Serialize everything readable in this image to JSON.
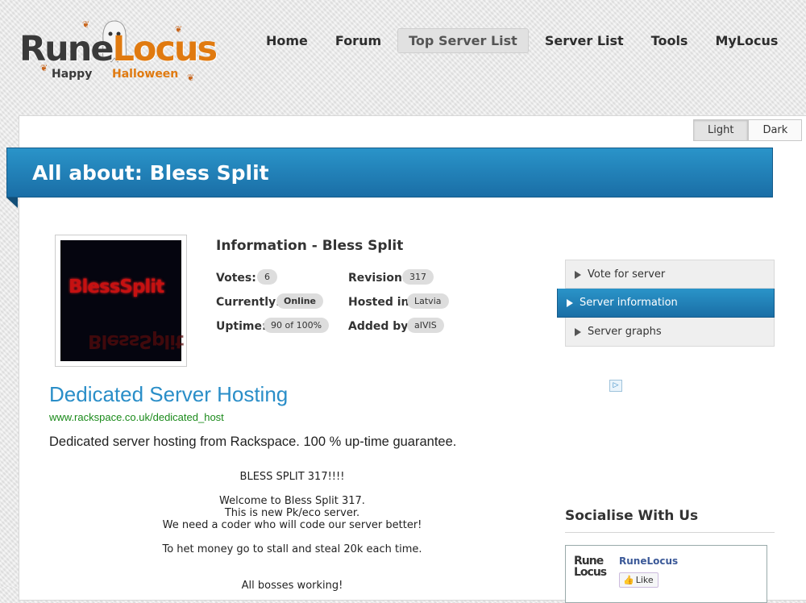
{
  "logo": {
    "word1": "Rune",
    "word2": "Locus",
    "happy": "Happy",
    "halloween": "Halloween"
  },
  "nav": {
    "items": [
      {
        "label": "Home",
        "active": false
      },
      {
        "label": "Forum",
        "active": false
      },
      {
        "label": "Top Server List",
        "active": true
      },
      {
        "label": "Server List",
        "active": false
      },
      {
        "label": "Tools",
        "active": false
      },
      {
        "label": "MyLocus",
        "active": false
      }
    ]
  },
  "theme": {
    "light": "Light",
    "dark": "Dark",
    "selected": "Light"
  },
  "banner": {
    "title": "All about: Bless Split"
  },
  "server_image": {
    "text": "BlessSplit"
  },
  "info": {
    "title": "Information - Bless Split",
    "votes_label": "Votes:",
    "votes_value": "6",
    "currently_label": "Currently:",
    "currently_value": "Online",
    "uptime_label": "Uptime:",
    "uptime_value": "90 of 100%",
    "revision_label": "Revision:",
    "revision_value": "317",
    "hosted_label": "Hosted in:",
    "hosted_value": "Latvia",
    "added_label": "Added by:",
    "added_value": "aIVIS"
  },
  "side_menu": {
    "items": [
      {
        "label": "Vote for server",
        "active": false
      },
      {
        "label": "Server information",
        "active": true
      },
      {
        "label": "Server graphs",
        "active": false
      }
    ]
  },
  "ad": {
    "title": "Dedicated Server Hosting",
    "url": "www.rackspace.co.uk/dedicated_host",
    "description": "Dedicated server hosting from Rackspace. 100 % up-time guarantee."
  },
  "description": {
    "heading": "BLESS SPLIT 317!!!!",
    "line1": "Welcome to Bless Split 317.",
    "line2": "This is new Pk/eco server.",
    "line3": "We need a coder who will code our server better!",
    "line4": "To het money go to stall and steal 20k each time.",
    "line5": "All bosses working!"
  },
  "social": {
    "title": "Socialise With Us",
    "fb_logo_line1": "Rune",
    "fb_logo_line2": "Locus",
    "fb_name": "RuneLocus",
    "fb_like": "Like"
  },
  "colors": {
    "accent_blue": "#1f7fb8",
    "brand_orange": "#e07a10",
    "ad_link": "#2a8ec8",
    "ad_url": "#1a8a1a"
  }
}
